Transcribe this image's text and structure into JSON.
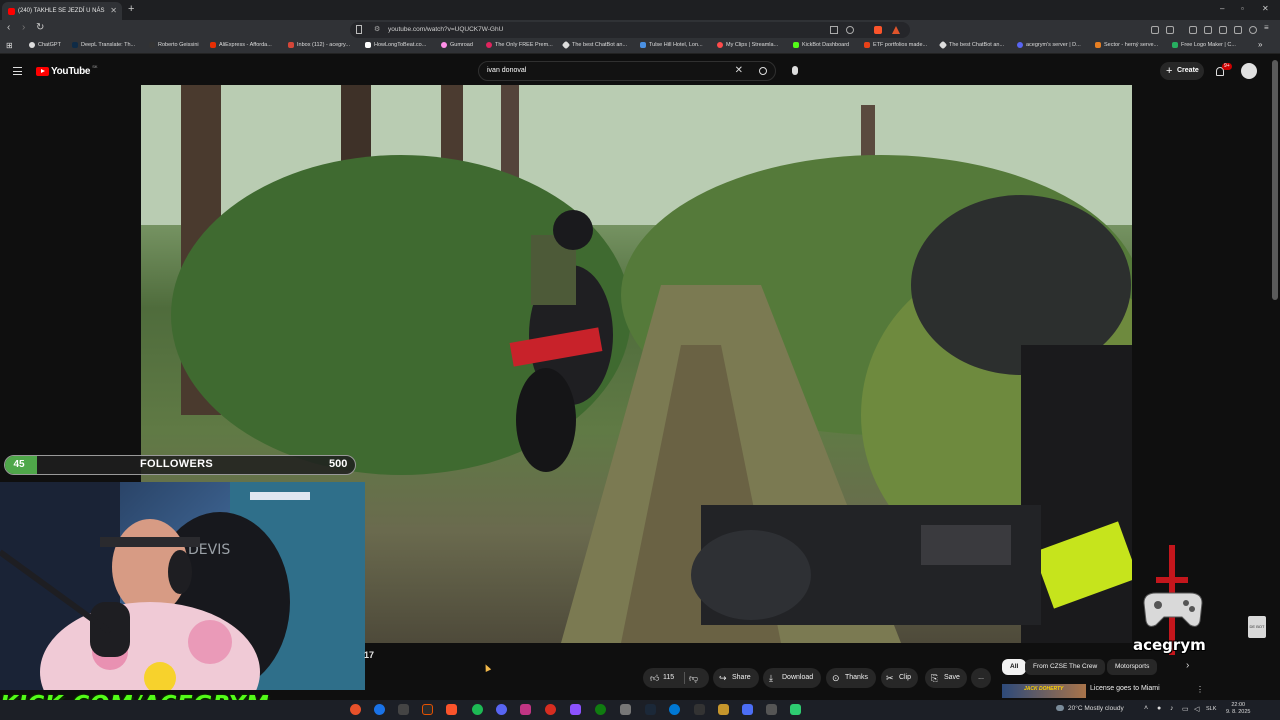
{
  "browser": {
    "tab_title": "(240) TAKHLE SE JEZDÍ U NÁS",
    "url": "youtube.com/watch?v=UQUCK7W-GhU",
    "bookmarks": [
      "ChatGPT",
      "DeepL Translate: Th...",
      "Roberto Geissini",
      "AliExpress - Afforda...",
      "Inbox (112) - acegry...",
      "HowLongToBeat.co...",
      "Gumroad",
      "The Only FREE Prem...",
      "The best ChatBot an...",
      "Tulse Hill Hotel, Lon...",
      "My Clips | Streamla...",
      "KickBot Dashboard",
      "ETF portfolios made...",
      "The best ChatBot an...",
      "acegrym's server | D...",
      "Sector - herný serve...",
      "Free Logo Maker | C..."
    ]
  },
  "youtube": {
    "logo_text": "YouTube",
    "country": "SK",
    "search_value": "ivan donoval",
    "create_label": "Create",
    "notification_count": "9+",
    "timecode_fragment": "17",
    "likes": "115",
    "share_label": "Share",
    "download_label": "Download",
    "thanks_label": "Thanks",
    "clip_label": "Clip",
    "save_label": "Save",
    "more_label": "...",
    "chips": [
      "All",
      "From CZSE The Crew",
      "Motorsports"
    ],
    "rec_title": "License goes to Miami",
    "rec_thumb_text": "JACK DOHERTY",
    "rec_menu": "⋮"
  },
  "overlay": {
    "followers_current": "45",
    "followers_label": "FOLLOWERS",
    "followers_goal": "500",
    "followers_progress": 0.09,
    "kick_banner": "KICK.COM/ACEGRYM",
    "channel_logo_text": "acegrym",
    "side_icon_text": "DE BOT"
  },
  "taskbar": {
    "temperature": "20°C",
    "weather": "Mostly cloudy",
    "language": "SLK",
    "time": "22:00",
    "date": "9. 8. 2025"
  },
  "colors": {
    "youtube_red": "#ff0000",
    "kick_green": "#53fc18",
    "followers_green": "#4fa74a"
  }
}
